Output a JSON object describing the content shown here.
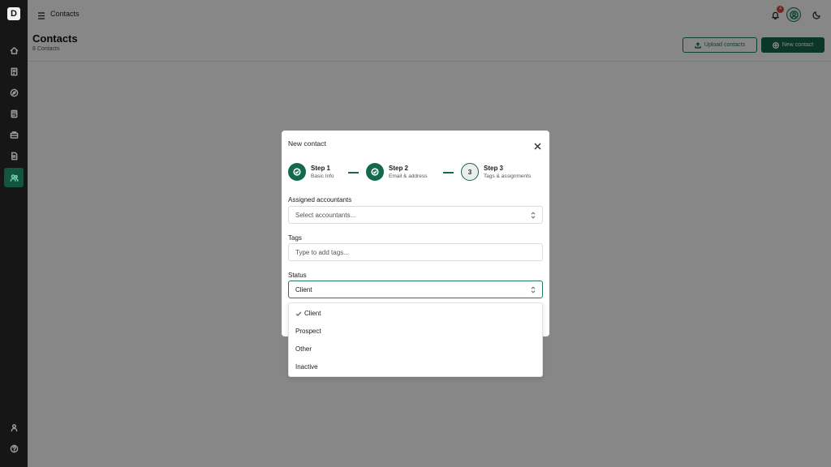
{
  "app": {
    "logo_text": "D"
  },
  "sidebar": {
    "items": [
      {
        "name": "home-icon"
      },
      {
        "name": "building-icon"
      },
      {
        "name": "compass-icon"
      },
      {
        "name": "calculator-icon"
      },
      {
        "name": "briefcase-icon"
      },
      {
        "name": "document-icon"
      },
      {
        "name": "users-icon",
        "active": true
      }
    ],
    "bottom_items": [
      {
        "name": "user-icon"
      },
      {
        "name": "help-icon"
      }
    ]
  },
  "topbar": {
    "title": "Contacts",
    "notification_count": "4"
  },
  "page": {
    "title": "Contacts",
    "subtitle": "8 Contacts",
    "upload_label": "Upload contacts",
    "new_label": "New contact"
  },
  "modal": {
    "title": "New contact",
    "steps": [
      {
        "label": "Step 1",
        "desc": "Basic Info",
        "state": "done"
      },
      {
        "label": "Step 2",
        "desc": "Email & address",
        "state": "done"
      },
      {
        "label": "Step 3",
        "desc": "Tags & assignments",
        "state": "current",
        "number": "3"
      }
    ],
    "assigned": {
      "label": "Assigned accountants",
      "placeholder": "Select accountants..."
    },
    "tags": {
      "label": "Tags",
      "placeholder": "Type to add tags..."
    },
    "status": {
      "label": "Status",
      "value": "Client",
      "options": [
        "Client",
        "Prospect",
        "Other",
        "Inactive"
      ]
    }
  },
  "colors": {
    "accent": "#13694a",
    "sidebar_bg": "#161616",
    "badge": "#d8483c"
  }
}
